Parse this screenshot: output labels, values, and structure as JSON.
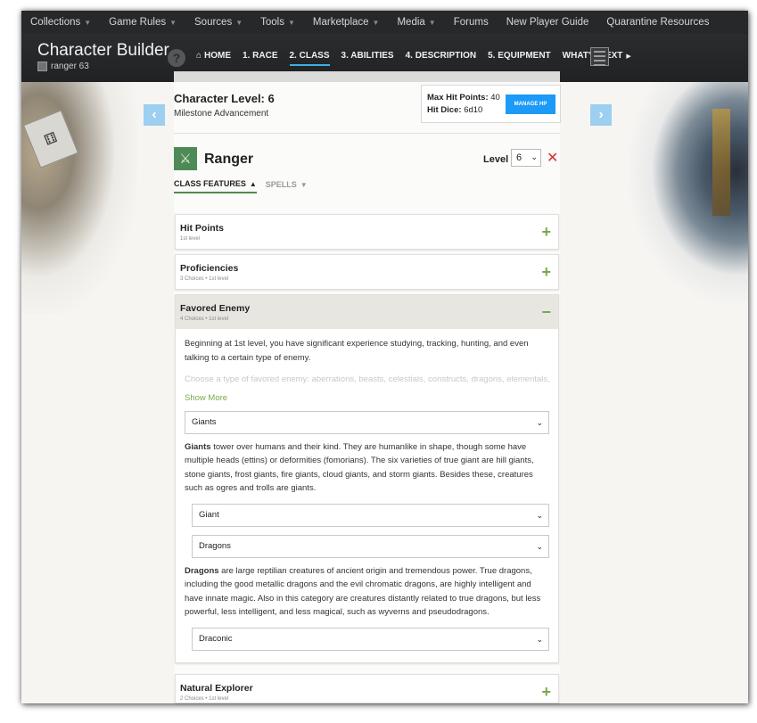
{
  "topnav": {
    "items": [
      {
        "label": "Collections",
        "dropdown": true
      },
      {
        "label": "Game Rules",
        "dropdown": true
      },
      {
        "label": "Sources",
        "dropdown": true
      },
      {
        "label": "Tools",
        "dropdown": true
      },
      {
        "label": "Marketplace",
        "dropdown": true
      },
      {
        "label": "Media",
        "dropdown": true
      },
      {
        "label": "Forums",
        "dropdown": false
      },
      {
        "label": "New Player Guide",
        "dropdown": false
      },
      {
        "label": "Quarantine Resources",
        "dropdown": false
      }
    ]
  },
  "header": {
    "title": "Character Builder",
    "username": "ranger 63",
    "help_label": "?",
    "steps": [
      {
        "label": "HOME",
        "icon": "home-icon"
      },
      {
        "label": "1. RACE"
      },
      {
        "label": "2. CLASS",
        "active": true
      },
      {
        "label": "3. ABILITIES"
      },
      {
        "label": "4. DESCRIPTION"
      },
      {
        "label": "5. EQUIPMENT"
      },
      {
        "label": "WHAT'S NEXT"
      }
    ]
  },
  "summary": {
    "character_level": "Character Level: 6",
    "advancement": "Milestone Advancement",
    "max_hp_label": "Max Hit Points:",
    "max_hp_value": "40",
    "hit_dice_label": "Hit Dice:",
    "hit_dice_value": "6d10",
    "manage_hp_label": "MANAGE HP"
  },
  "class": {
    "name": "Ranger",
    "level_label": "Level",
    "level_value": "6",
    "remove_label": "✕",
    "tabs": [
      {
        "label": "CLASS FEATURES",
        "active": true,
        "chevron": "▲"
      },
      {
        "label": "SPELLS",
        "active": false,
        "chevron": "▼"
      }
    ]
  },
  "features": [
    {
      "title": "Hit Points",
      "meta": "1st level",
      "toggle": "+"
    },
    {
      "title": "Proficiencies",
      "meta": "3 Choices • 1st level",
      "toggle": "+"
    },
    {
      "title": "Favored Enemy",
      "meta": "4 Choices • 1st level",
      "toggle": "−",
      "intro": "Beginning at 1st level, you have significant experience studying, tracking, hunting, and even talking to a certain type of enemy.",
      "faded": "Choose a type of favored enemy: aberrations, beasts, celestials, constructs, dragons, elementals,",
      "show_more": "Show More",
      "choice1": "Giants",
      "choice1_bold": "Giants",
      "choice1_desc": " tower over humans and their kind. They are humanlike in shape, though some have multiple heads (ettins) or deformities (fomorians). The six varieties of true giant are hill giants, stone giants, frost giants, fire giants, cloud giants, and storm giants. Besides these, creatures such as ogres and trolls are giants.",
      "choice1_sub": "Giant",
      "choice2": "Dragons",
      "choice2_bold": "Dragons",
      "choice2_desc": " are large reptilian creatures of ancient origin and tremendous power. True dragons, including the good metallic dragons and the evil chromatic dragons, are highly intelligent and have innate magic. Also in this category are creatures distantly related to true dragons, but less powerful, less intelligent, and less magical, such as wyverns and pseudodragons.",
      "choice2_sub": "Draconic"
    },
    {
      "title": "Natural Explorer",
      "meta": "2 Choices • 1st level",
      "toggle": "+"
    }
  ],
  "colors": {
    "accent_blue": "#1b9af7",
    "accent_green": "#7aa84b",
    "nav_bg": "#262829"
  }
}
